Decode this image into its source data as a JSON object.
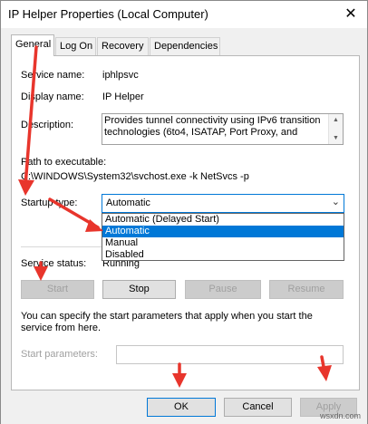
{
  "window": {
    "title": "IP Helper Properties (Local Computer)"
  },
  "tabs": [
    {
      "label": "General"
    },
    {
      "label": "Log On"
    },
    {
      "label": "Recovery"
    },
    {
      "label": "Dependencies"
    }
  ],
  "general": {
    "service_name_label": "Service name:",
    "service_name_value": "iphlpsvc",
    "display_name_label": "Display name:",
    "display_name_value": "IP Helper",
    "description_label": "Description:",
    "description_value": "Provides tunnel connectivity using IPv6 transition technologies (6to4, ISATAP, Port Proxy, and",
    "path_label": "Path to executable:",
    "path_value": "C:\\WINDOWS\\System32\\svchost.exe -k NetSvcs -p",
    "startup_type_label": "Startup type:",
    "startup_type_value": "Automatic",
    "startup_options": [
      "Automatic (Delayed Start)",
      "Automatic",
      "Manual",
      "Disabled"
    ],
    "service_status_label": "Service status:",
    "service_status_value": "Running",
    "start_button": "Start",
    "stop_button": "Stop",
    "pause_button": "Pause",
    "resume_button": "Resume",
    "help_text": "You can specify the start parameters that apply when you start the service from here.",
    "start_params_label": "Start parameters:",
    "start_params_value": ""
  },
  "footer": {
    "ok_button": "OK",
    "cancel_button": "Cancel",
    "apply_button": "Apply"
  },
  "watermark": "wsxdn.com",
  "colors": {
    "selection": "#0078d7",
    "annotation_arrow": "#e8352c"
  }
}
